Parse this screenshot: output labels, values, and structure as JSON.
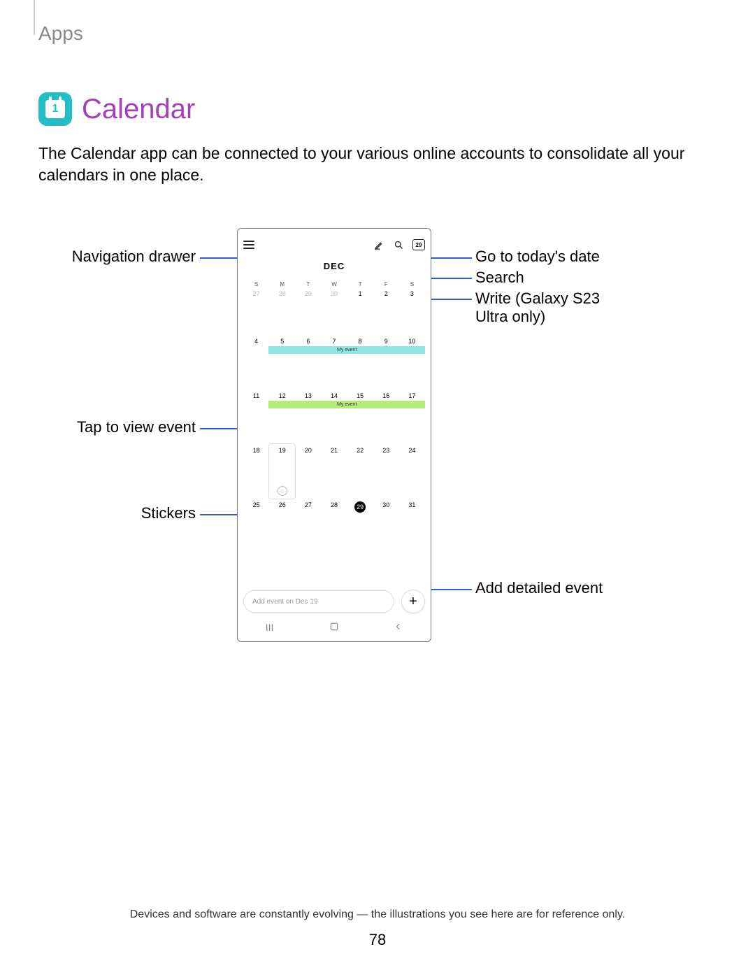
{
  "header": {
    "section": "Apps"
  },
  "title": {
    "icon_num": "1",
    "text": "Calendar"
  },
  "intro": "The Calendar app can be connected to your various online accounts to consolidate all your calendars in one place.",
  "callouts": {
    "nav_drawer": "Navigation drawer",
    "goto_today": "Go to today's date",
    "search": "Search",
    "write": "Write (Galaxy S23 Ultra only)",
    "tap_event": "Tap to view event",
    "stickers": "Stickers",
    "add_event": "Add detailed event"
  },
  "phone": {
    "month": "DEC",
    "today_badge": "29",
    "dow": [
      "S",
      "M",
      "T",
      "W",
      "T",
      "F",
      "S"
    ],
    "weeks": [
      [
        "27",
        "28",
        "29",
        "30",
        "1",
        "2",
        "3"
      ],
      [
        "4",
        "5",
        "6",
        "7",
        "8",
        "9",
        "10"
      ],
      [
        "11",
        "12",
        "13",
        "14",
        "15",
        "16",
        "17"
      ],
      [
        "18",
        "19",
        "20",
        "21",
        "22",
        "23",
        "24"
      ],
      [
        "25",
        "26",
        "27",
        "28",
        "29",
        "30",
        "31"
      ]
    ],
    "event_label": "My event",
    "add_placeholder": "Add event on Dec 19"
  },
  "footer": {
    "disclaimer": "Devices and software are constantly evolving — the illustrations you see here are for reference only.",
    "page": "78"
  }
}
